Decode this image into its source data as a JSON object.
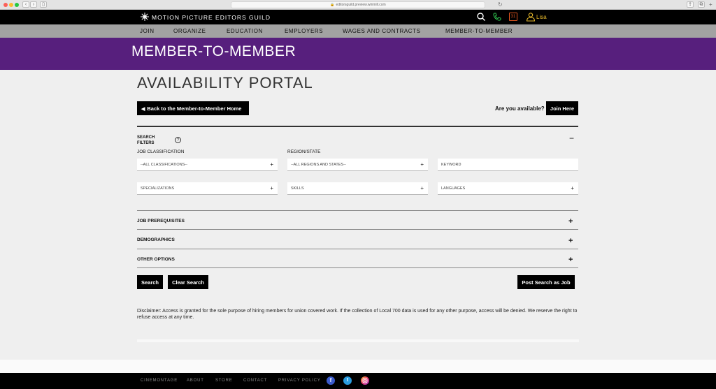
{
  "browser": {
    "url": "editorsguild.preview.winmill.com"
  },
  "header": {
    "brand": "MOTION PICTURE EDITORS GUILD",
    "calendar_day": "31",
    "user_name": "Lisa"
  },
  "nav": {
    "items": [
      "JOIN",
      "ORGANIZE",
      "EDUCATION",
      "EMPLOYERS",
      "WAGES AND CONTRACTS",
      "MEMBER-TO-MEMBER"
    ]
  },
  "banner": {
    "title": "MEMBER-TO-MEMBER"
  },
  "page": {
    "title": "AVAILABILITY PORTAL",
    "back_button": "Back to the Member-to-Member Home",
    "available_question": "Are you available?",
    "join_button": "Join Here"
  },
  "filters": {
    "label": "SEARCH FILTERS",
    "help": "?",
    "collapse": "−",
    "job_classification_label": "JOB CLASSIFICATION",
    "region_label": "REGION/STATE",
    "job_classification_value": "--ALL CLASSIFICATIONS--",
    "region_value": "--ALL REGIONS AND STATES--",
    "keyword_placeholder": "KEYWORD",
    "specializations": "SPECIALIZATIONS",
    "skills": "SKILLS",
    "languages": "LANGUAGES",
    "plus": "+"
  },
  "accordions": {
    "job_prerequisites": "JOB PREREQUISITES",
    "demographics": "DEMOGRAPHICS",
    "other_options": "OTHER OPTIONS",
    "plus": "+"
  },
  "actions": {
    "search": "Search",
    "clear": "Clear Search",
    "post": "Post Search as Job"
  },
  "disclaimer": "Disclaimer: Access is granted for the sole purpose of hiring members for union covered work. If the collection of Local 700 data is used for any other purpose, access will be denied. We reserve the right to refuse access at any time.",
  "footer": {
    "links": [
      "CINEMONTAGE",
      "ABOUT",
      "STORE",
      "CONTACT",
      "PRIVACY POLICY"
    ],
    "social": [
      "facebook-icon",
      "twitter-icon",
      "instagram-icon"
    ]
  },
  "colors": {
    "banner_purple": "#571f7d",
    "calendar_orange": "#e0551f",
    "phone_green": "#2db84b",
    "user_gold": "#e2b52a",
    "facebook_blue": "#3b5bcc",
    "twitter_blue": "#2a9de0"
  }
}
